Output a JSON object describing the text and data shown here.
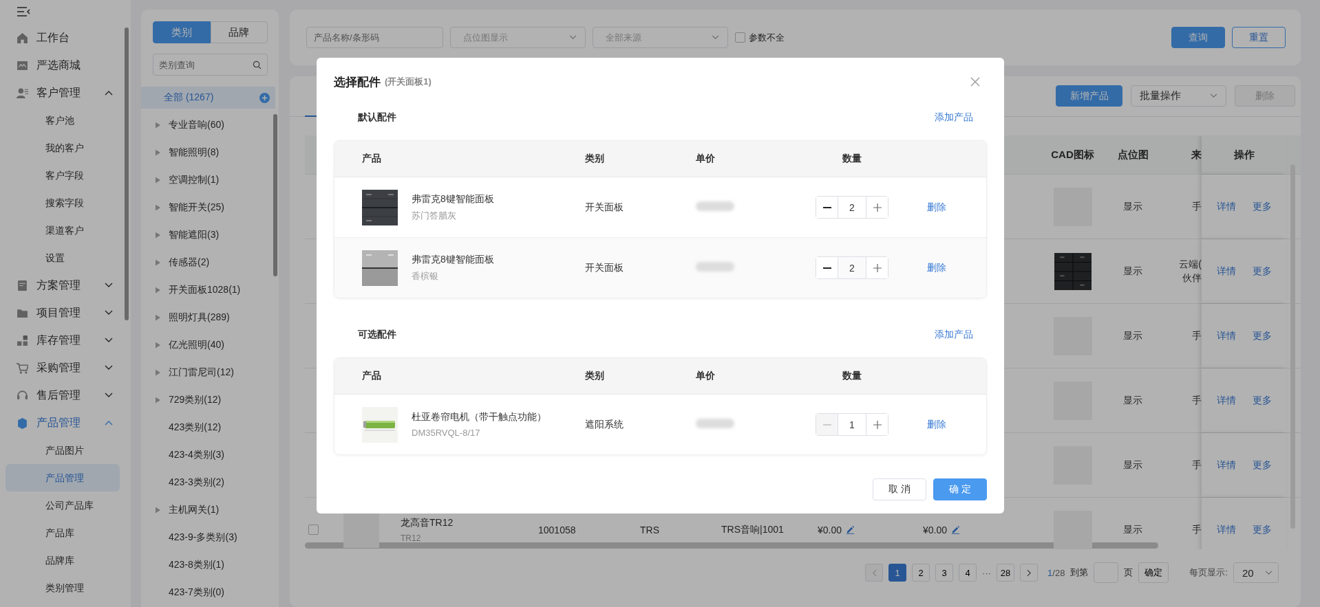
{
  "sidebar": {
    "items": [
      {
        "label": "工作台",
        "kind": "link",
        "selected": false
      },
      {
        "label": "严选商城",
        "kind": "link",
        "selected": false
      },
      {
        "label": "客户管理",
        "kind": "group",
        "selected": false,
        "expanded": true,
        "children": [
          {
            "label": "客户池",
            "selected": false
          },
          {
            "label": "我的客户",
            "selected": false
          },
          {
            "label": "客户字段",
            "selected": false
          },
          {
            "label": "搜索字段",
            "selected": false
          },
          {
            "label": "渠道客户",
            "selected": false
          },
          {
            "label": "设置",
            "selected": false
          }
        ]
      },
      {
        "label": "方案管理",
        "kind": "group",
        "selected": false,
        "expanded": false
      },
      {
        "label": "项目管理",
        "kind": "group",
        "selected": false,
        "expanded": false
      },
      {
        "label": "库存管理",
        "kind": "group",
        "selected": false,
        "expanded": false
      },
      {
        "label": "采购管理",
        "kind": "group",
        "selected": false,
        "expanded": false
      },
      {
        "label": "售后管理",
        "kind": "group",
        "selected": false,
        "expanded": false
      },
      {
        "label": "产品管理",
        "kind": "group",
        "selected": true,
        "expanded": true,
        "children": [
          {
            "label": "产品图片",
            "selected": false
          },
          {
            "label": "产品管理",
            "selected": true
          },
          {
            "label": "公司产品库",
            "selected": false
          },
          {
            "label": "产品库",
            "selected": false
          },
          {
            "label": "品牌库",
            "selected": false
          },
          {
            "label": "类别管理",
            "selected": false
          }
        ]
      }
    ]
  },
  "category_panel": {
    "tabs": [
      {
        "label": "类别",
        "selected": true
      },
      {
        "label": "品牌",
        "selected": false
      }
    ],
    "search": {
      "placeholder": "类别查询"
    },
    "items": [
      {
        "label": "全部 (1267)",
        "expandable": false,
        "selected": true
      },
      {
        "label": "专业音响(60)",
        "expandable": true,
        "selected": false
      },
      {
        "label": "智能照明(8)",
        "expandable": true,
        "selected": false
      },
      {
        "label": "空调控制(1)",
        "expandable": true,
        "selected": false
      },
      {
        "label": "智能开关(25)",
        "expandable": true,
        "selected": false
      },
      {
        "label": "智能遮阳(3)",
        "expandable": true,
        "selected": false
      },
      {
        "label": "传感器(2)",
        "expandable": true,
        "selected": false
      },
      {
        "label": "开关面板1028(1)",
        "expandable": true,
        "selected": false
      },
      {
        "label": "照明灯具(289)",
        "expandable": true,
        "selected": false
      },
      {
        "label": "亿光照明(40)",
        "expandable": true,
        "selected": false
      },
      {
        "label": "江门雷尼司(12)",
        "expandable": true,
        "selected": false
      },
      {
        "label": "729类别(12)",
        "expandable": true,
        "selected": false
      },
      {
        "label": "423类别(12)",
        "expandable": false,
        "selected": false
      },
      {
        "label": "423-4类别(3)",
        "expandable": false,
        "selected": false
      },
      {
        "label": "423-3类别(2)",
        "expandable": false,
        "selected": false
      },
      {
        "label": "主机网关(1)",
        "expandable": true,
        "selected": false
      },
      {
        "label": "423-9-多类别(3)",
        "expandable": false,
        "selected": false
      },
      {
        "label": "423-8类别(1)",
        "expandable": false,
        "selected": false
      },
      {
        "label": "423-7类别(0)",
        "expandable": false,
        "selected": false
      }
    ]
  },
  "filters": {
    "search": {
      "placeholder": "产品名称/条形码"
    },
    "selects": [
      {
        "placeholder": "点位图显示"
      },
      {
        "placeholder": "全部来源"
      }
    ],
    "checkbox": {
      "label": "参数不全",
      "checked": false
    },
    "buttons": [
      {
        "label": "查询",
        "kind": "primary"
      },
      {
        "label": "重置",
        "kind": "outline"
      }
    ]
  },
  "toolbar": {
    "buttons": [
      {
        "label": "新增产品",
        "kind": "primary"
      },
      {
        "label": "批量操作",
        "kind": "select"
      },
      {
        "label": "删除",
        "kind": "plain",
        "disabled": true
      }
    ]
  },
  "table": {
    "columns": [
      "CAD图标",
      "点位图",
      "来",
      "操作"
    ],
    "rows": [
      {
        "cad_picture": false,
        "point_map": "显示",
        "source": [
          "手"
        ],
        "actions": [
          "详情",
          "更多"
        ]
      },
      {
        "cad_picture": true,
        "point_map": "显示",
        "source": [
          "云端(",
          "伙伴"
        ],
        "actions": [
          "详情",
          "更多"
        ]
      },
      {
        "cad_picture": false,
        "point_map": "显示",
        "source": [
          "手"
        ],
        "actions": [
          "详情",
          "更多"
        ]
      },
      {
        "cad_picture": false,
        "point_map": "显示",
        "source": [
          "手"
        ],
        "actions": [
          "详情",
          "更多"
        ]
      },
      {
        "cad_picture": false,
        "point_map": "显示",
        "source": [
          "手"
        ],
        "actions": [
          "详情",
          "更多"
        ]
      },
      {
        "checked": false,
        "column_2": {
          "title": "龙高音TR12",
          "subtitle": "TR12"
        },
        "column_3": "1001058",
        "column_4": "TRS",
        "column_5": "TRS音响|1001",
        "column_6": "¥0.00",
        "column_7": "¥0.00",
        "edit_icons": true,
        "cad_picture": false,
        "point_map": "显示",
        "source": [
          "手"
        ],
        "actions": [
          "详情",
          "更多"
        ]
      }
    ]
  },
  "pagination": {
    "pages": [
      {
        "label": "1",
        "selected": true
      },
      {
        "label": "2",
        "selected": false
      },
      {
        "label": "3",
        "selected": false
      },
      {
        "label": "4",
        "selected": false
      },
      {
        "label": "28",
        "selected": false
      }
    ],
    "ellipsis": "···",
    "current": "1",
    "total": "/28",
    "goto_label": "到第",
    "page_unit": "页",
    "confirm": "确定",
    "page_size_label": "每页显示:",
    "page_size": "20"
  },
  "dialog": {
    "title": "选择配件",
    "subtitle": "(开关面板1)",
    "sections": [
      {
        "title": "默认配件",
        "add_link": "添加产品",
        "columns": [
          "产品",
          "类别",
          "单价",
          "数量"
        ],
        "rows": [
          {
            "name": "弗雷克8键智能面板",
            "variant": "苏门答腊灰",
            "category": "开关面板",
            "quantity": "2",
            "min_disabled": false,
            "delete": "删除"
          },
          {
            "name": "弗雷克8键智能面板",
            "variant": "香槟银",
            "category": "开关面板",
            "quantity": "2",
            "min_disabled": false,
            "delete": "删除"
          }
        ]
      },
      {
        "title": "可选配件",
        "add_link": "添加产品",
        "columns": [
          "产品",
          "类别",
          "单价",
          "数量"
        ],
        "rows": [
          {
            "name": "杜亚卷帘电机（带干触点功能）",
            "variant": "DM35RVQL-8/17",
            "category": "遮阳系统",
            "quantity": "1",
            "min_disabled": true,
            "delete": "删除"
          }
        ]
      }
    ],
    "buttons": [
      {
        "label": "取 消",
        "kind": "cancel"
      },
      {
        "label": "确 定",
        "kind": "primary"
      }
    ]
  }
}
